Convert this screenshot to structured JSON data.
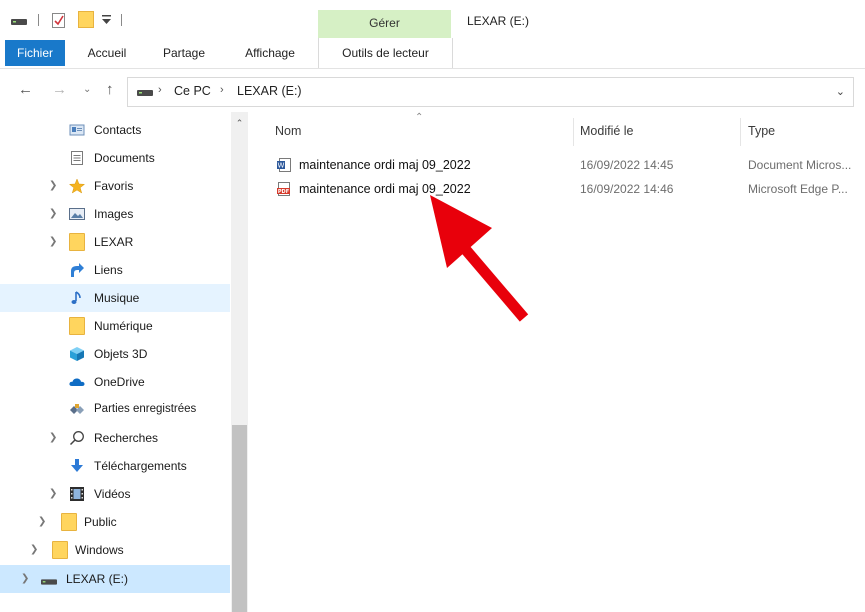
{
  "window": {
    "title": "LEXAR (E:)"
  },
  "ribbon": {
    "manage_label": "Gérer",
    "tabs": [
      {
        "label": "Fichier"
      },
      {
        "label": "Accueil"
      },
      {
        "label": "Partage"
      },
      {
        "label": "Affichage"
      },
      {
        "label": "Outils de lecteur"
      }
    ]
  },
  "address": {
    "crumbs": [
      {
        "label": "Ce PC"
      },
      {
        "label": "LEXAR (E:)"
      }
    ]
  },
  "nav": {
    "items": [
      {
        "label": "Contacts",
        "icon": "contacts-icon"
      },
      {
        "label": "Documents",
        "icon": "documents-icon"
      },
      {
        "label": "Favoris",
        "icon": "star-icon"
      },
      {
        "label": "Images",
        "icon": "images-icon"
      },
      {
        "label": "LEXAR",
        "icon": "folder-icon"
      },
      {
        "label": "Liens",
        "icon": "link-arrow-icon"
      },
      {
        "label": "Musique",
        "icon": "music-note-icon"
      },
      {
        "label": "Numérique",
        "icon": "folder-icon"
      },
      {
        "label": "Objets 3D",
        "icon": "cube-3d-icon"
      },
      {
        "label": "OneDrive",
        "icon": "cloud-icon"
      },
      {
        "label": "Parties enregistrées",
        "icon": "saved-games-icon"
      },
      {
        "label": "Recherches",
        "icon": "search-icon"
      },
      {
        "label": "Téléchargements",
        "icon": "download-arrow-icon"
      },
      {
        "label": "Vidéos",
        "icon": "film-icon"
      },
      {
        "label": "Public",
        "icon": "folder-icon"
      },
      {
        "label": "Windows",
        "icon": "folder-icon"
      },
      {
        "label": "LEXAR (E:)",
        "icon": "drive-icon"
      }
    ]
  },
  "filelist": {
    "columns": {
      "name": "Nom",
      "modified": "Modifié le",
      "type": "Type"
    },
    "files": [
      {
        "name": "maintenance ordi maj 09_2022",
        "modified": "16/09/2022 14:45",
        "type": "Document Micros...",
        "icon": "word-document-icon"
      },
      {
        "name": "maintenance ordi maj 09_2022",
        "modified": "16/09/2022 14:46",
        "type": "Microsoft Edge P...",
        "icon": "pdf-icon"
      }
    ]
  },
  "annotation": {
    "color": "#e8000b",
    "icon": "red-arrow-annotation"
  },
  "colors": {
    "accent": "#1979ca",
    "manage_band": "#d6f0c5",
    "selection": "#cce8ff",
    "hover": "#e5f3ff"
  }
}
